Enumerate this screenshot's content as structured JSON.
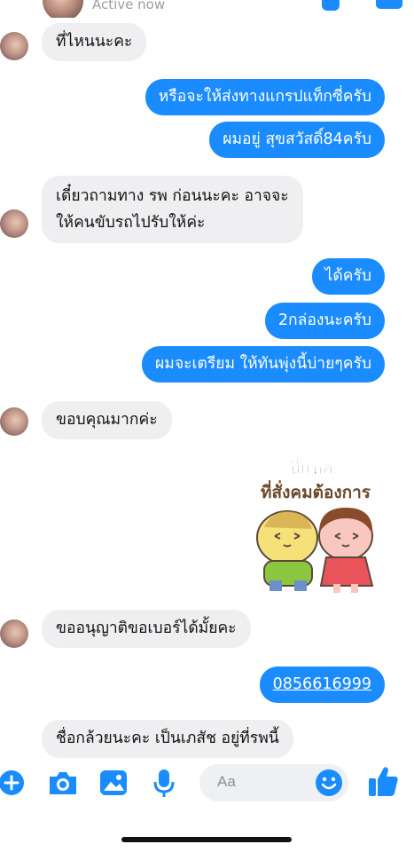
{
  "header": {
    "status": "Active now"
  },
  "messages": [
    {
      "from": "them",
      "text": "ที่ไหนนะคะ"
    },
    {
      "from": "me",
      "text": "หรือจะให้ส่งทางแกรปแท็กซี่ครับ"
    },
    {
      "from": "me",
      "text": "ผมอยู่ สุขสวัสดิ์84ครับ"
    },
    {
      "from": "them",
      "lines": [
        "เดี๋ยวถามทาง รพ ก่อนนะคะ อาจจะ",
        "ให้คนขับรถไปรับให้ค่ะ"
      ]
    },
    {
      "from": "me",
      "text": "ได้ครับ"
    },
    {
      "from": "me",
      "text": "2กล่องนะครับ"
    },
    {
      "from": "me",
      "text": "ผมจะเตรียม ให้ทันพุ่งนี้บ่ายๆครับ"
    },
    {
      "from": "them",
      "text": "ขอบคุณมากค่ะ"
    },
    {
      "from": "them",
      "text": "ขออนุญาติขอเบอร์ได้มั้ยคะ"
    },
    {
      "from": "me",
      "text": "0856616999",
      "link": true
    },
    {
      "from": "them",
      "text": "ชื่อกล้วยนะคะ เป็นเภสัช อยู่ที่รพนี้"
    }
  ],
  "sticker": {
    "line1": "นี่แหล่ะ",
    "line2": "ที่สั่งคมต้องการ"
  },
  "composer": {
    "placeholder": "Aa",
    "icons": [
      "plus-icon",
      "camera-icon",
      "gallery-icon",
      "microphone-icon",
      "emoji-icon",
      "thumbs-up-icon"
    ]
  },
  "colors": {
    "accent": "#1a8cff",
    "incoming_bubble": "#efeff1"
  }
}
